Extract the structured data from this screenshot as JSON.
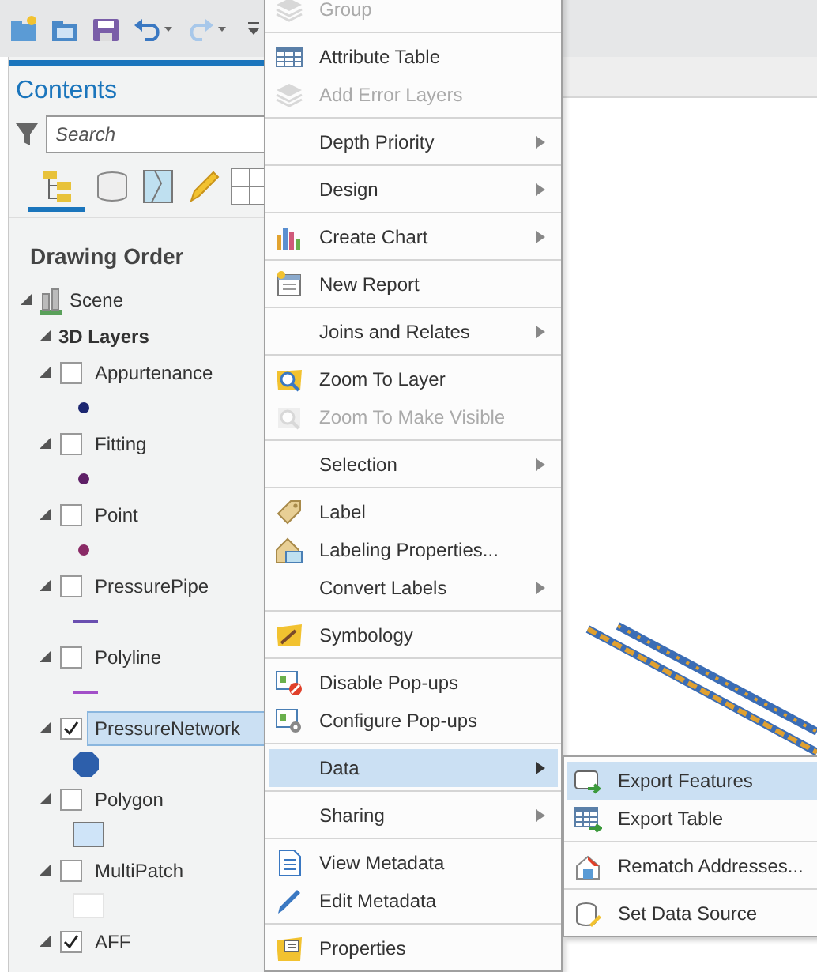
{
  "contents": {
    "title": "Contents",
    "search": {
      "placeholder": "Search"
    },
    "view_tabs": [
      {
        "selected": true
      },
      {
        "selected": false
      },
      {
        "selected": false
      },
      {
        "selected": false
      },
      {
        "selected": false
      }
    ],
    "heading": "Drawing Order",
    "tree": {
      "kind": "scene",
      "label": "Scene",
      "expanded": true,
      "children": [
        {
          "kind": "group",
          "label": "3D Layers",
          "expanded": true,
          "children": [
            {
              "kind": "layer",
              "label": "Appurtenance",
              "checked": false,
              "selected": false,
              "expanded": true,
              "symbol": {
                "kind": "point",
                "color": "#1c2670"
              }
            },
            {
              "kind": "layer",
              "label": "Fitting",
              "checked": false,
              "selected": false,
              "expanded": true,
              "symbol": {
                "kind": "point",
                "color": "#5e1f66"
              }
            },
            {
              "kind": "layer",
              "label": "Point",
              "checked": false,
              "selected": false,
              "expanded": true,
              "symbol": {
                "kind": "point",
                "color": "#8a2a66"
              }
            },
            {
              "kind": "layer",
              "label": "PressurePipe",
              "checked": false,
              "selected": false,
              "expanded": true,
              "symbol": {
                "kind": "line",
                "color": "#6a4fb0"
              }
            },
            {
              "kind": "layer",
              "label": "Polyline",
              "checked": false,
              "selected": false,
              "expanded": true,
              "symbol": {
                "kind": "line",
                "color": "#a24fc8"
              }
            },
            {
              "kind": "layer",
              "label": "PressureNetwork",
              "checked": true,
              "selected": true,
              "expanded": true,
              "symbol": {
                "kind": "hexagon",
                "color": "#2d5fab"
              }
            },
            {
              "kind": "layer",
              "label": "Polygon",
              "checked": false,
              "selected": false,
              "expanded": true,
              "symbol": {
                "kind": "fill",
                "color": "#cfe4f8"
              }
            },
            {
              "kind": "layer",
              "label": "MultiPatch",
              "checked": false,
              "selected": false,
              "expanded": true,
              "symbol": {
                "kind": "fill",
                "color": "#ffffff"
              }
            },
            {
              "kind": "layer",
              "label": "AFF",
              "checked": true,
              "selected": false,
              "expanded": true
            }
          ]
        }
      ]
    }
  },
  "context_menu": {
    "groups": [
      {
        "items": [
          {
            "label": "Group",
            "disabled": true,
            "submenu": false,
            "selected": false
          }
        ]
      },
      {
        "items": [
          {
            "label": "Attribute Table",
            "disabled": false,
            "submenu": false,
            "selected": false
          },
          {
            "label": "Add Error Layers",
            "disabled": true,
            "submenu": false,
            "selected": false
          }
        ]
      },
      {
        "items": [
          {
            "label": "Depth Priority",
            "disabled": false,
            "submenu": true,
            "selected": false
          }
        ]
      },
      {
        "items": [
          {
            "label": "Design",
            "disabled": false,
            "submenu": true,
            "selected": false
          }
        ]
      },
      {
        "items": [
          {
            "label": "Create Chart",
            "disabled": false,
            "submenu": true,
            "selected": false
          }
        ]
      },
      {
        "items": [
          {
            "label": "New Report",
            "disabled": false,
            "submenu": false,
            "selected": false
          }
        ]
      },
      {
        "items": [
          {
            "label": "Joins and Relates",
            "disabled": false,
            "submenu": true,
            "selected": false
          }
        ]
      },
      {
        "items": [
          {
            "label": "Zoom To Layer",
            "disabled": false,
            "submenu": false,
            "selected": false
          },
          {
            "label": "Zoom To Make Visible",
            "disabled": true,
            "submenu": false,
            "selected": false
          }
        ]
      },
      {
        "items": [
          {
            "label": "Selection",
            "disabled": false,
            "submenu": true,
            "selected": false
          }
        ]
      },
      {
        "items": [
          {
            "label": "Label",
            "disabled": false,
            "submenu": false,
            "selected": false
          },
          {
            "label": "Labeling Properties...",
            "disabled": false,
            "submenu": false,
            "selected": false
          },
          {
            "label": "Convert Labels",
            "disabled": false,
            "submenu": true,
            "selected": false
          }
        ]
      },
      {
        "items": [
          {
            "label": "Symbology",
            "disabled": false,
            "submenu": false,
            "selected": false
          }
        ]
      },
      {
        "items": [
          {
            "label": "Disable Pop-ups",
            "disabled": false,
            "submenu": false,
            "selected": false
          },
          {
            "label": "Configure Pop-ups",
            "disabled": false,
            "submenu": false,
            "selected": false
          }
        ]
      },
      {
        "items": [
          {
            "label": "Data",
            "disabled": false,
            "submenu": true,
            "selected": true
          }
        ]
      },
      {
        "items": [
          {
            "label": "Sharing",
            "disabled": false,
            "submenu": true,
            "selected": false
          }
        ]
      },
      {
        "items": [
          {
            "label": "View Metadata",
            "disabled": false,
            "submenu": false,
            "selected": false
          },
          {
            "label": "Edit Metadata",
            "disabled": false,
            "submenu": false,
            "selected": false
          }
        ]
      },
      {
        "items": [
          {
            "label": "Properties",
            "disabled": false,
            "submenu": false,
            "selected": false
          }
        ]
      }
    ]
  },
  "data_submenu": {
    "groups": [
      {
        "items": [
          {
            "label": "Export Features",
            "disabled": false,
            "submenu": false,
            "selected": true
          },
          {
            "label": "Export Table",
            "disabled": false,
            "submenu": false,
            "selected": false
          }
        ]
      },
      {
        "items": [
          {
            "label": "Rematch Addresses...",
            "disabled": false,
            "submenu": false,
            "selected": false
          }
        ]
      },
      {
        "items": [
          {
            "label": "Set Data Source",
            "disabled": false,
            "submenu": false,
            "selected": false
          }
        ]
      }
    ]
  }
}
